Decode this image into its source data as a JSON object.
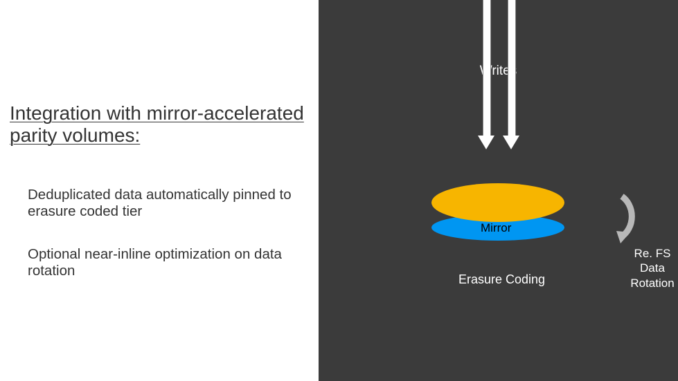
{
  "heading": "Integration with mirror-accelerated parity volumes:",
  "body": {
    "p1": "Deduplicated data automatically pinned to erasure coded tier",
    "p2": "Optional near-inline optimization on data rotation"
  },
  "diagram": {
    "writes_label": "Writes",
    "mirror_label": "Mirror",
    "erasure_label": "Erasure Coding",
    "rotation_label_l1": "Re. FS",
    "rotation_label_l2": "Data",
    "rotation_label_l3": "Rotation"
  },
  "colors": {
    "yellow": "#f7b500",
    "blue": "#0096f2",
    "dark_bg": "#3b3b3b"
  }
}
